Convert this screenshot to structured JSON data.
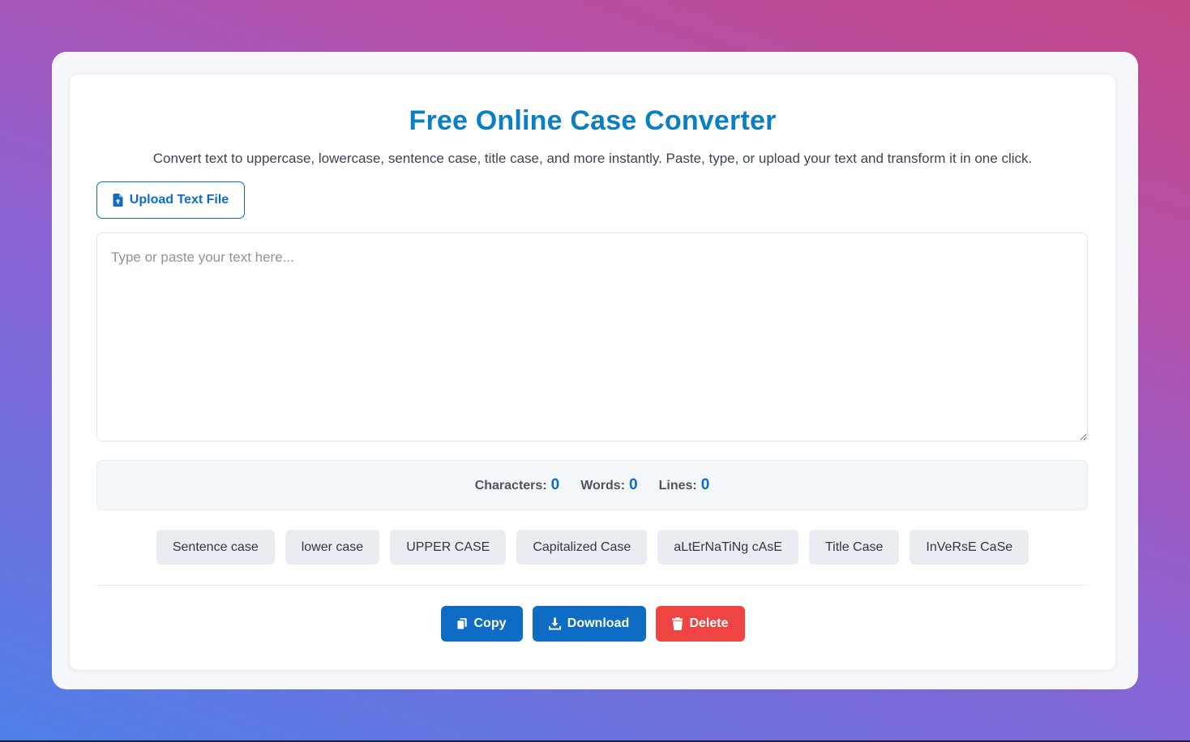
{
  "header": {
    "title": "Free Online Case Converter",
    "subtitle": "Convert text to uppercase, lowercase, sentence case, title case, and more instantly. Paste, type, or upload your text and transform it in one click."
  },
  "upload": {
    "label": "Upload Text File",
    "icon": "file-upload-icon"
  },
  "editor": {
    "placeholder": "Type or paste your text here...",
    "value": ""
  },
  "stats": {
    "characters_label": "Characters:",
    "characters": "0",
    "words_label": "Words:",
    "words": "0",
    "lines_label": "Lines:",
    "lines": "0"
  },
  "case_buttons": [
    "Sentence case",
    "lower case",
    "UPPER CASE",
    "Capitalized Case",
    "aLtErNaTiNg cAsE",
    "Title Case",
    "InVeRsE CaSe"
  ],
  "actions": {
    "copy": {
      "label": "Copy",
      "icon": "copy-icon"
    },
    "download": {
      "label": "Download",
      "icon": "download-icon"
    },
    "delete": {
      "label": "Delete",
      "icon": "trash-icon"
    }
  },
  "colors": {
    "accent": "#0e6cc4",
    "title": "#0b7fc4",
    "danger": "#ef4444",
    "background_gradient": [
      "#4f7fe8",
      "#8c62d3",
      "#c44887"
    ]
  }
}
